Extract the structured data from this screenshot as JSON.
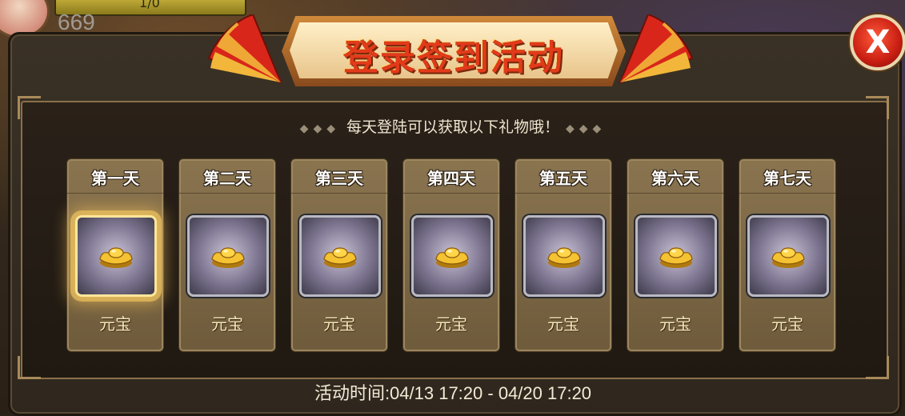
{
  "hud": {
    "top_value": "1/0",
    "number": "669"
  },
  "title": "登录签到活动",
  "subtitle": "每天登陆可以获取以下礼物哦！",
  "close_label": "X",
  "days": [
    {
      "label": "第一天",
      "item": "元宝",
      "active": true
    },
    {
      "label": "第二天",
      "item": "元宝",
      "active": false
    },
    {
      "label": "第三天",
      "item": "元宝",
      "active": false
    },
    {
      "label": "第四天",
      "item": "元宝",
      "active": false
    },
    {
      "label": "第五天",
      "item": "元宝",
      "active": false
    },
    {
      "label": "第六天",
      "item": "元宝",
      "active": false
    },
    {
      "label": "第七天",
      "item": "元宝",
      "active": false
    }
  ],
  "activity_time": "活动时间:04/13 17:20  -  04/20 17:20",
  "icons": {
    "reward": "gold-ingot-icon",
    "close": "close-icon",
    "decor": "fan-icon"
  },
  "colors": {
    "title": "#e23a1a",
    "panel": "#2f271d",
    "card": "#7a6446",
    "close": "#c81e12"
  }
}
